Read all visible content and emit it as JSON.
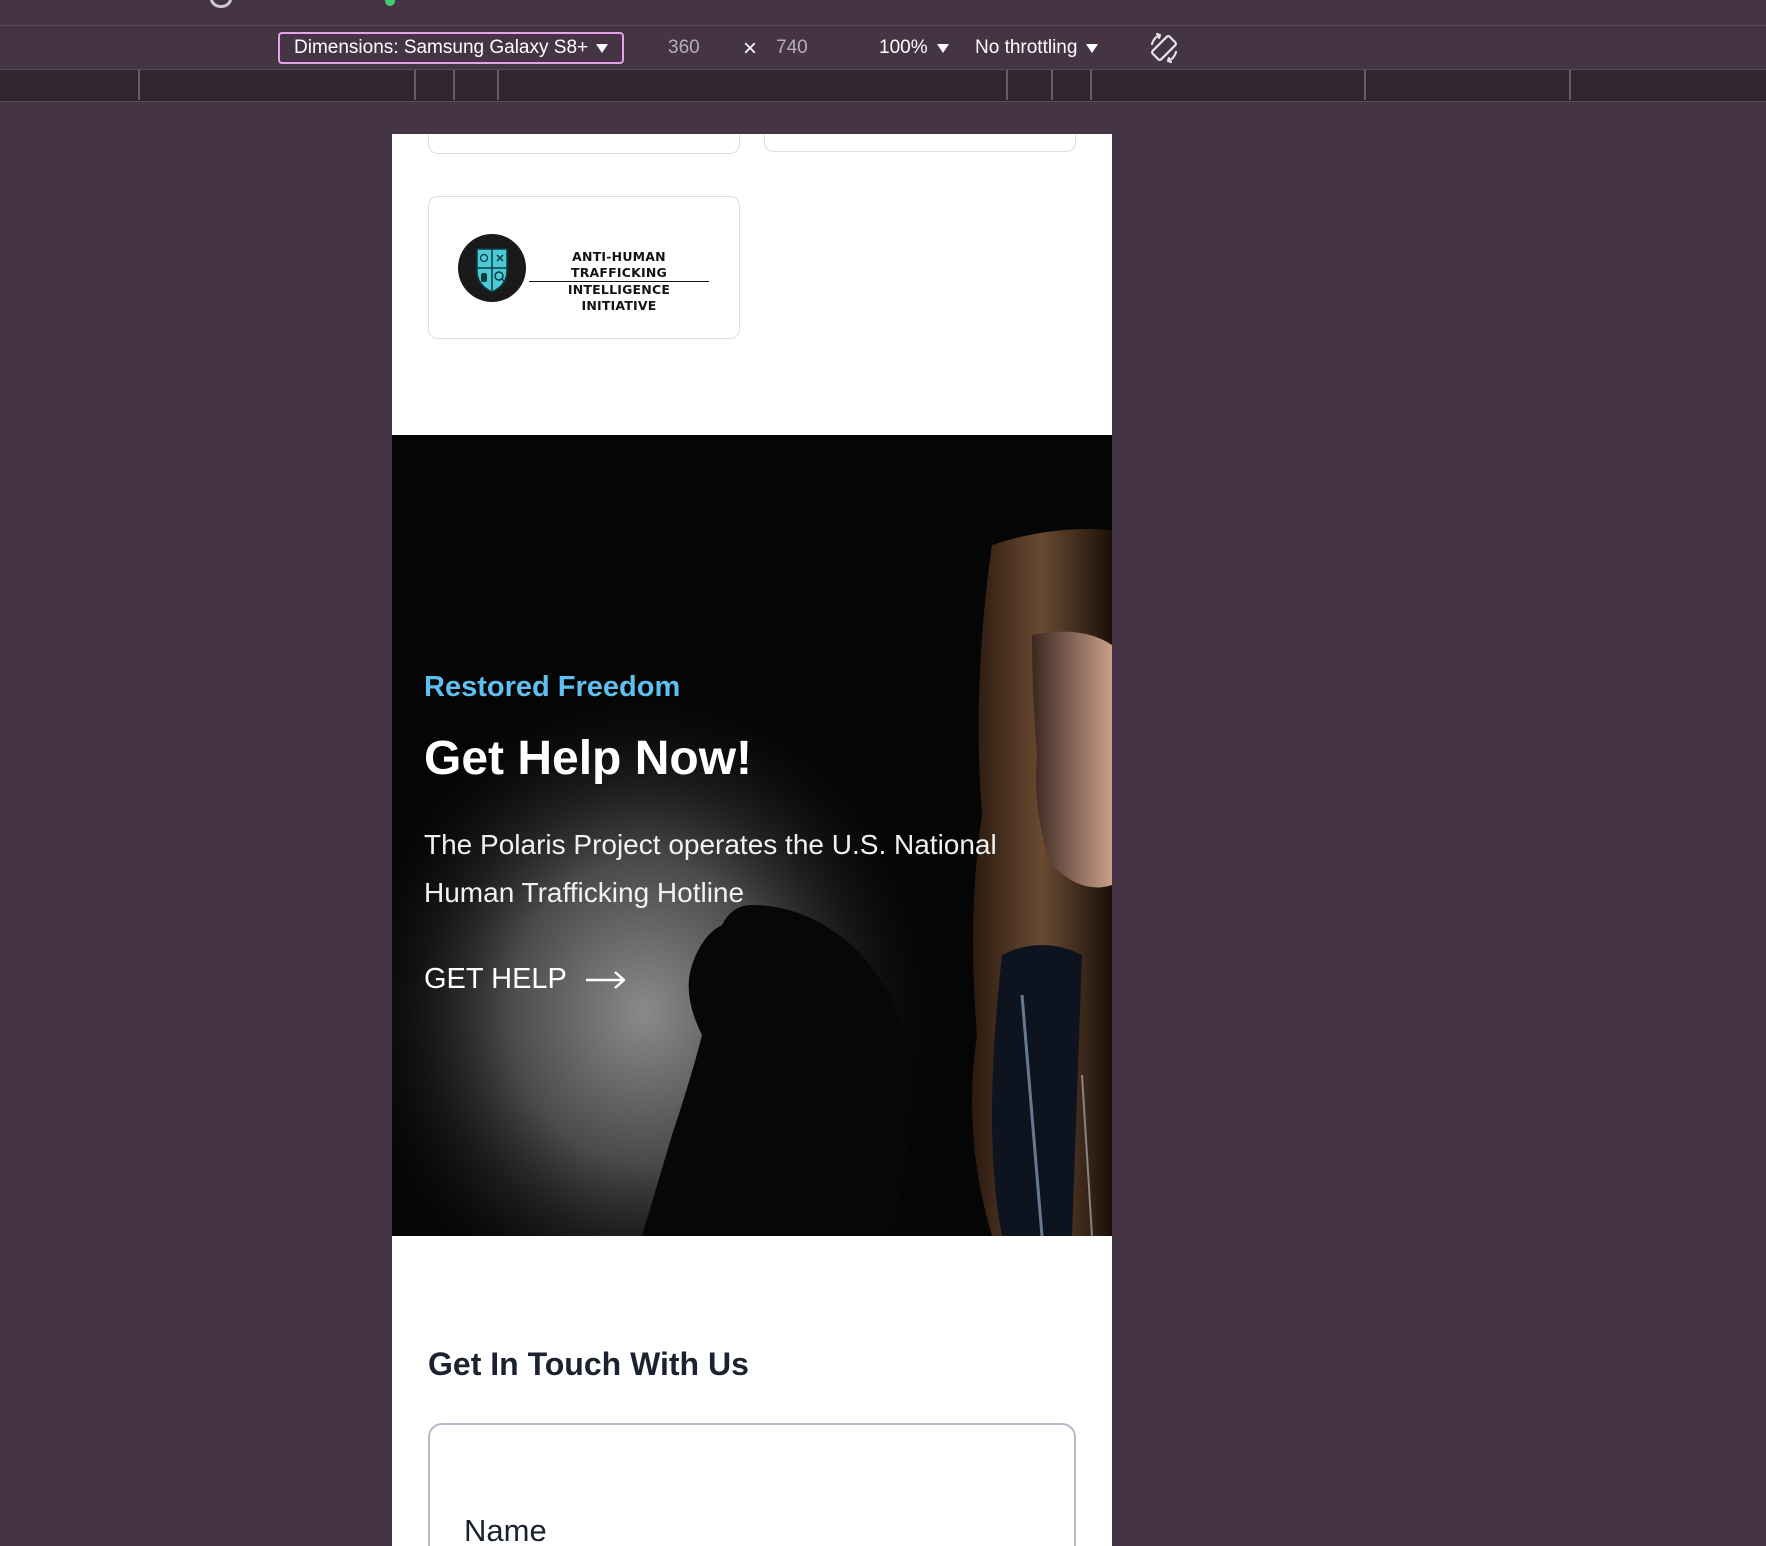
{
  "devtools": {
    "dimensions_label": "Dimensions: Samsung Galaxy S8+",
    "width": "360",
    "height": "740",
    "times_symbol": "×",
    "zoom": "100%",
    "throttling": "No throttling"
  },
  "page": {
    "partner_logo": {
      "line1": "ANTI-HUMAN TRAFFICKING",
      "line2": "INTELLIGENCE INITIATIVE"
    },
    "hero": {
      "eyebrow": "Restored Freedom",
      "title": "Get Help Now!",
      "body": "The Polaris Project operates the U.S. National Human Trafficking Hotline",
      "cta_label": "GET HELP"
    },
    "contact": {
      "title": "Get In Touch With Us",
      "name_label": "Name"
    }
  },
  "colors": {
    "devtools_bg": "#453444",
    "accent_outline": "#e3a3e6",
    "eyebrow": "#5fc0f0",
    "emblem_teal": "#4cc9d6"
  },
  "icons": [
    "caret-down-icon",
    "times-icon",
    "rotate-icon",
    "arrow-right-icon",
    "shield-emblem-icon"
  ]
}
